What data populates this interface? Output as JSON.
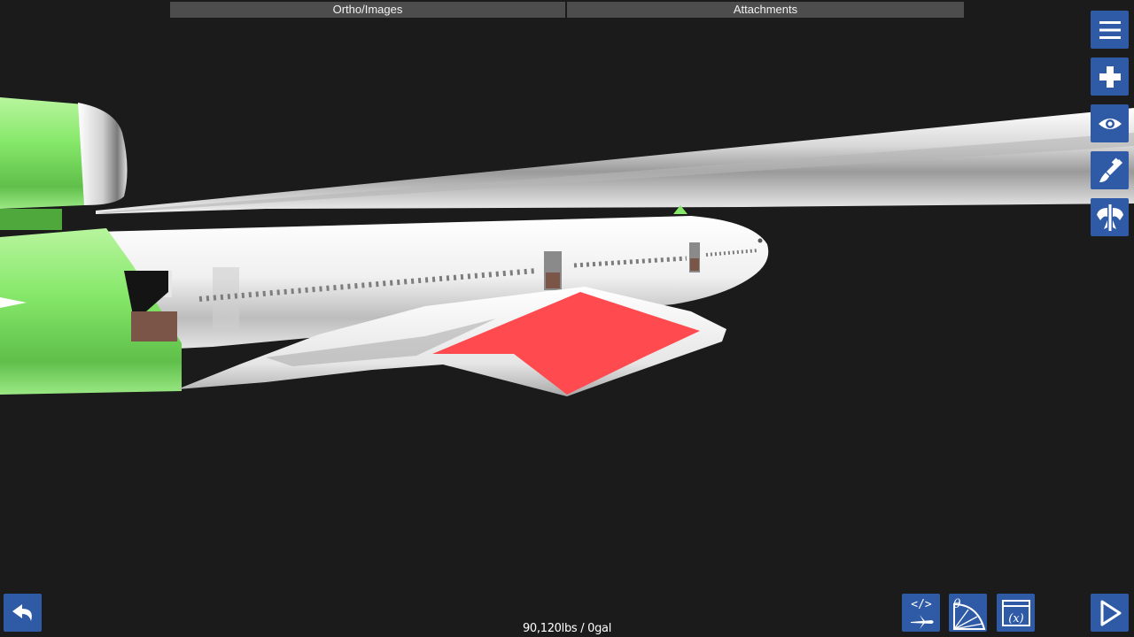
{
  "top_tabs": {
    "ortho_label": "Ortho/Images",
    "attachments_label": "Attachments"
  },
  "right_toolbar": {
    "icons": [
      "menu-icon",
      "add-part-icon",
      "view-eye-icon",
      "paint-brush-icon",
      "symmetry-icon"
    ]
  },
  "bottom_toolbar": {
    "icons": [
      "undo-icon",
      "code-plane-icon",
      "theta-protractor-icon",
      "variables-icon",
      "play-icon"
    ]
  },
  "status": {
    "mass_text": "90,120lbs / 0gal"
  },
  "colors": {
    "background": "#1b1b1b",
    "button_blue": "#2f5ba6",
    "tab_gray": "#4d4d4d",
    "engine_green": "#86e86a",
    "wing_red": "#ff4b4f"
  }
}
